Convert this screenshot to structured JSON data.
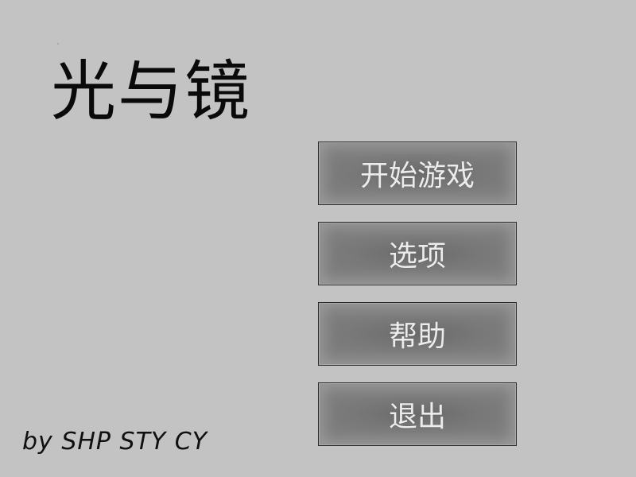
{
  "game": {
    "title": "光与镜",
    "credits": "by SHP STY CY"
  },
  "menu": {
    "items": [
      {
        "id": "start",
        "label": "开始游戏"
      },
      {
        "id": "options",
        "label": "选项"
      },
      {
        "id": "help",
        "label": "帮助"
      },
      {
        "id": "quit",
        "label": "退出"
      }
    ]
  },
  "colors": {
    "background": "#c3c3c3",
    "button_fill": "#7c7c7c",
    "button_text": "#ececec",
    "title_text": "#0a0a0a"
  }
}
